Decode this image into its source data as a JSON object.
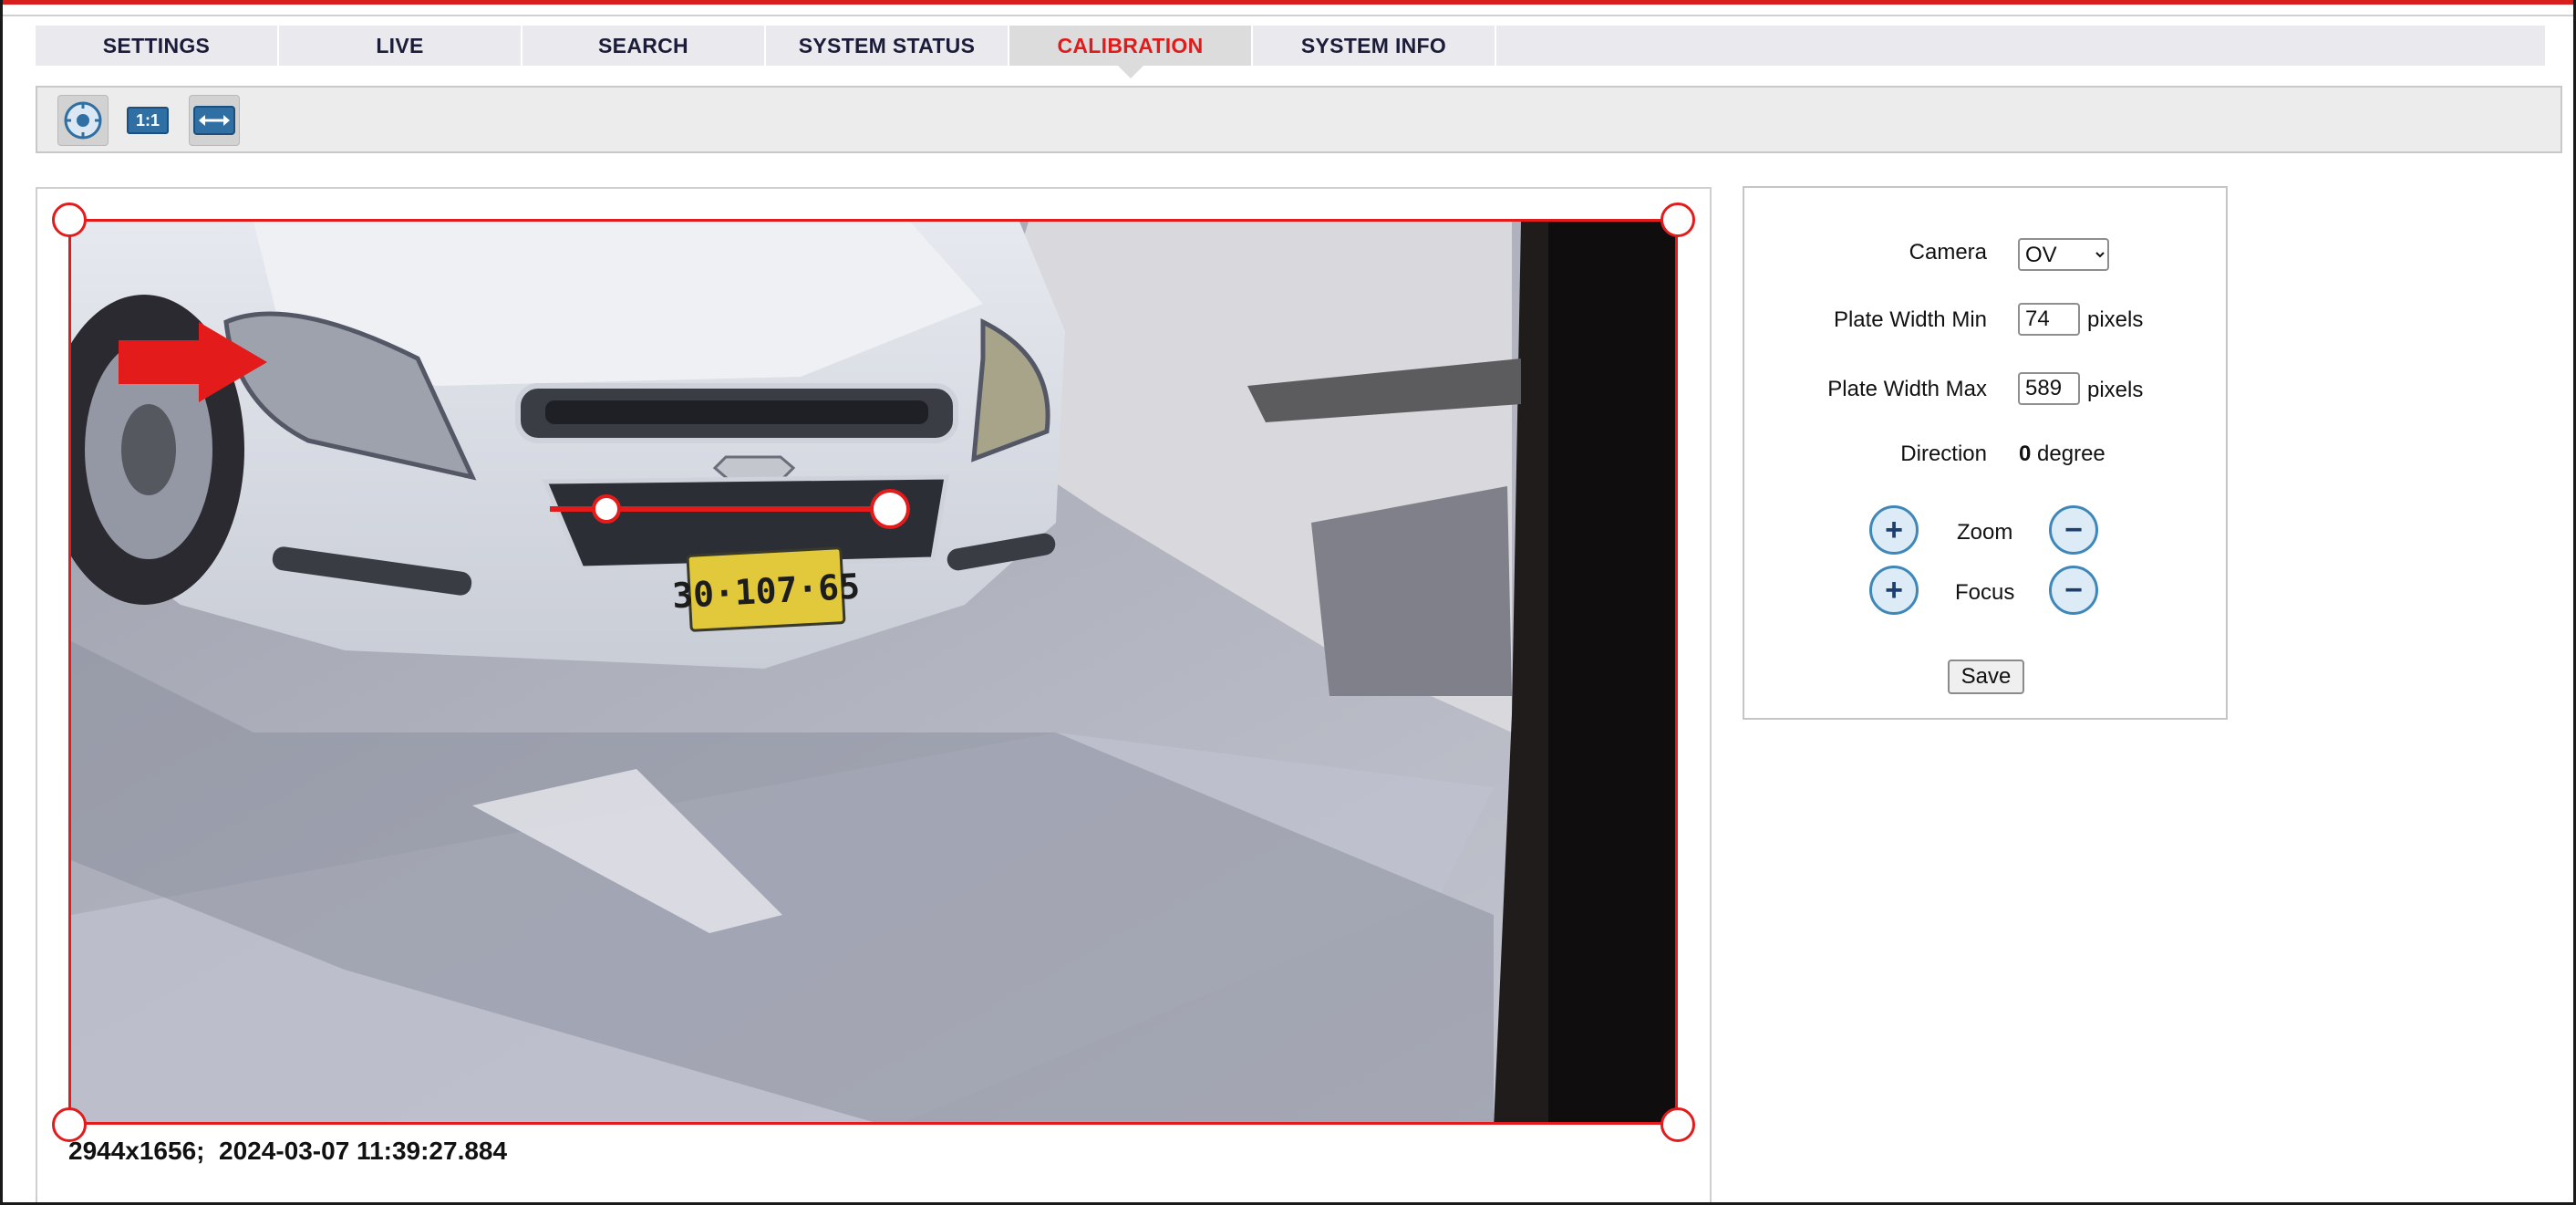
{
  "nav": {
    "tabs": [
      {
        "label": "SETTINGS"
      },
      {
        "label": "LIVE"
      },
      {
        "label": "SEARCH"
      },
      {
        "label": "SYSTEM STATUS"
      },
      {
        "label": "CALIBRATION",
        "active": true
      },
      {
        "label": "SYSTEM INFO"
      }
    ],
    "active_color": "#e01b1b"
  },
  "toolbar": {
    "tools": [
      {
        "icon": "target-icon",
        "pressed": true
      },
      {
        "icon": "actual-size-icon",
        "label": "1:1",
        "pressed": false
      },
      {
        "icon": "fit-width-icon",
        "pressed": true
      }
    ]
  },
  "image": {
    "plate_text": "30·107·65",
    "status": "2944x1656;  2024-03-07 11:39:27.884",
    "roi_color": "#e31b1b"
  },
  "calibration": {
    "camera_label": "Camera",
    "camera_value": "OV",
    "plate_min_label": "Plate Width Min",
    "plate_min_value": "74",
    "plate_max_label": "Plate Width Max",
    "plate_max_value": "589",
    "unit": "pixels",
    "direction_label": "Direction",
    "direction_value": "0",
    "direction_unit": "degree",
    "zoom_label": "Zoom",
    "focus_label": "Focus",
    "save_label": "Save"
  }
}
